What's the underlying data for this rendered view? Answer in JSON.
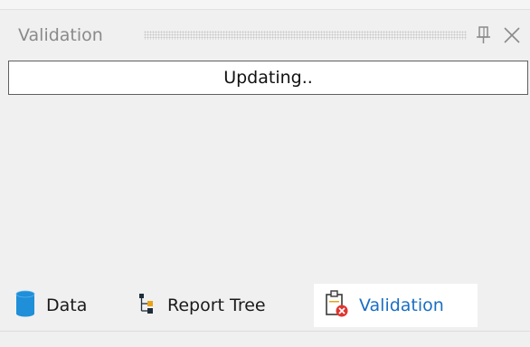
{
  "panel": {
    "title": "Validation",
    "pin_icon": "pin-icon",
    "close_icon": "close-icon"
  },
  "status": {
    "text": "Updating.."
  },
  "tabs": [
    {
      "label": "Data",
      "icon": "database-icon",
      "active": false
    },
    {
      "label": "Report Tree",
      "icon": "report-tree-icon",
      "active": false
    },
    {
      "label": "Validation",
      "icon": "clipboard-error-icon",
      "active": true
    }
  ],
  "colors": {
    "active_tab_text": "#1a6fc4",
    "database_icon": "#1e8fd8",
    "error_badge": "#e0352f",
    "tree_node_dark": "#1f2d3a",
    "tree_node_accent": "#e8a317"
  }
}
